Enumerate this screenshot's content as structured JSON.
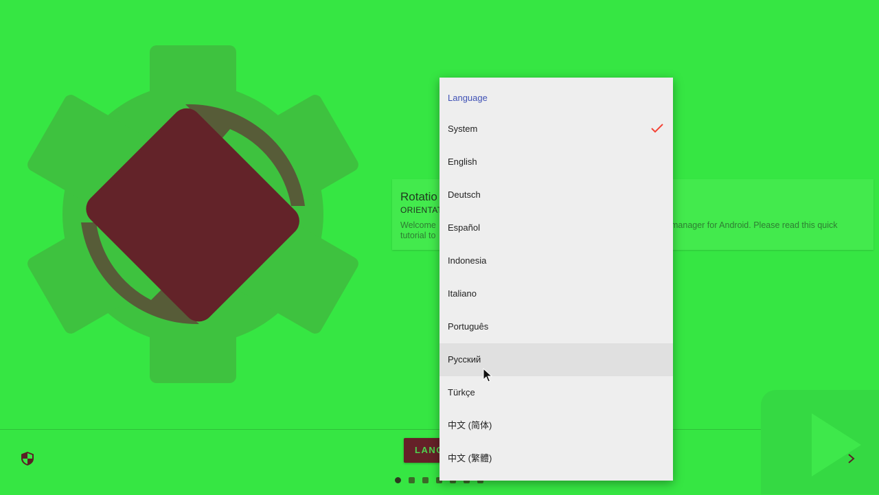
{
  "info_card": {
    "title": "Rotatio",
    "subtitle": "ORIENTAT",
    "description_left": "Welcome tutorial to",
    "description_right": "manager for Android. Please read this quick"
  },
  "bottom_bar": {
    "language_button": "LANG",
    "pager_dots": 7,
    "active_dot": 0
  },
  "language_menu": {
    "header": "Language",
    "selected": "System",
    "hovered": "Русский",
    "items": [
      "System",
      "English",
      "Deutsch",
      "Español",
      "Indonesia",
      "Italiano",
      "Português",
      "Русский",
      "Türkçe",
      "中文 (简体)",
      "中文 (繁體)"
    ]
  },
  "icons": {
    "hero": "gear-rotation-icon",
    "security": "shield-icon",
    "next": "chevron-right-icon",
    "check": "check-icon"
  },
  "colors": {
    "background": "#36e643",
    "accent": "#652128",
    "menu_header": "#3f51b5",
    "check": "#f44336"
  }
}
